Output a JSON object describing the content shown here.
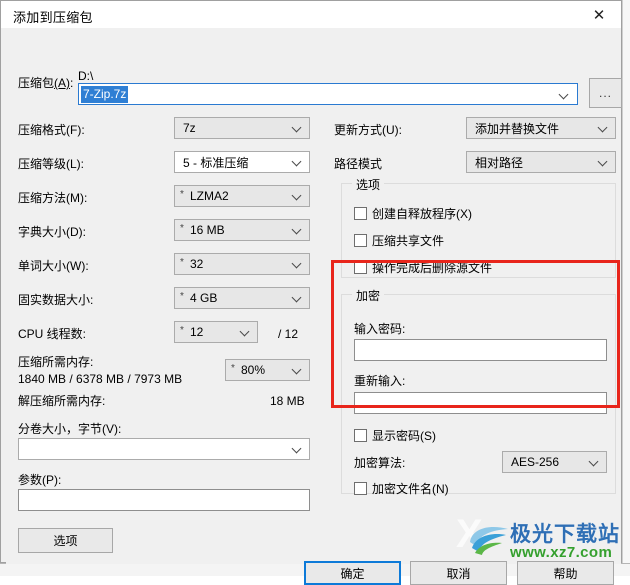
{
  "window": {
    "title": "添加到压缩包",
    "close_icon": "close-icon"
  },
  "archive": {
    "label": "压缩包(A)",
    "label_main": "压缩包",
    "label_accel": "(A)",
    "path": "D:\\",
    "filename": "7-Zip.7z",
    "browse_label": "..."
  },
  "left": {
    "format": {
      "label": "压缩格式(F):",
      "value": "7z",
      "starred": false
    },
    "level": {
      "label": "压缩等级(L):",
      "value": "5 - 标准压缩",
      "starred": false
    },
    "method": {
      "label": "压缩方法(M):",
      "value": "LZMA2",
      "starred": true
    },
    "dict": {
      "label": "字典大小(D):",
      "value": "16 MB",
      "starred": true
    },
    "word": {
      "label": "单词大小(W):",
      "value": "32",
      "starred": true
    },
    "solid": {
      "label": "固实数据大小:",
      "value": "4 GB",
      "starred": true
    },
    "cpu": {
      "label": "CPU 线程数:",
      "value": "12",
      "starred": true,
      "total": "/ 12"
    },
    "mem_compress_label": "压缩所需内存:",
    "mem_compress_value": "1840 MB / 6378 MB / 7973 MB",
    "mem_percent": {
      "value": "80%",
      "starred": true
    },
    "mem_decompress_label": "解压缩所需内存:",
    "mem_decompress_value": "18 MB",
    "volume": {
      "label": "分卷大小，字节(V):",
      "value": ""
    },
    "params": {
      "label": "参数(P):",
      "value": ""
    }
  },
  "right": {
    "update_mode": {
      "label": "更新方式(U):",
      "value": "添加并替换文件"
    },
    "path_mode": {
      "label": "路径模式",
      "value": "相对路径"
    },
    "options_group": "选项",
    "options": [
      {
        "label": "创建自释放程序(X)",
        "checked": false
      },
      {
        "label": "压缩共享文件",
        "checked": false
      },
      {
        "label": "操作完成后删除源文件",
        "checked": false
      }
    ],
    "encryption_group": "加密",
    "password_label": "输入密码:",
    "password_value": "",
    "password_repeat_label": "重新输入:",
    "password_repeat_value": "",
    "show_password": {
      "label": "显示密码(S)",
      "checked": false
    },
    "algorithm": {
      "label": "加密算法:",
      "value": "AES-256"
    },
    "encrypt_filenames": {
      "label": "加密文件名(N)",
      "checked": false
    }
  },
  "buttons": {
    "options": "选项",
    "ok": "确定",
    "cancel": "取消",
    "help": "帮助"
  },
  "watermark": {
    "name": "极光下载站",
    "url": "www.xz7.com"
  },
  "colors": {
    "dialog_bg": "#f0f0f0",
    "accent_blue": "#2f7fd4",
    "focus_blue": "#0d7ad8",
    "annotation_red": "#e8251b",
    "watermark_blue": "#2f6fb5",
    "watermark_green": "#35a02e"
  }
}
